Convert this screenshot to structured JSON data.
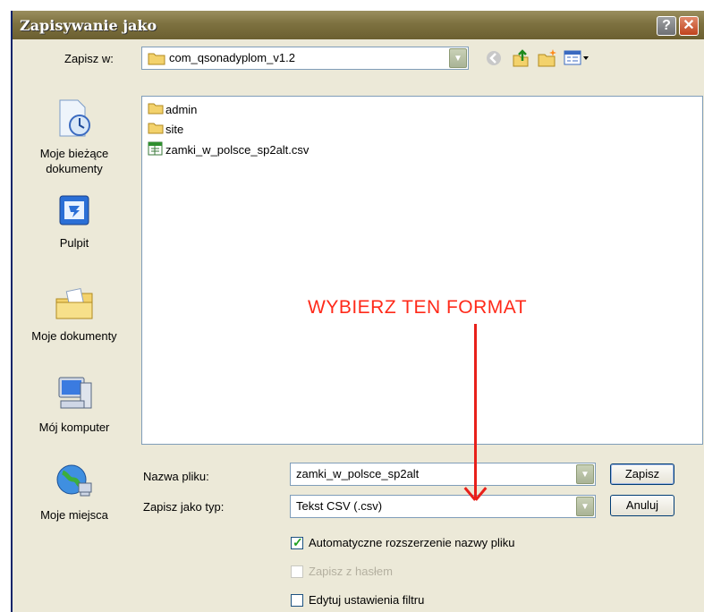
{
  "window": {
    "title": "Zapisywanie jako",
    "help_glyph": "?",
    "close_glyph": "✕"
  },
  "savein": {
    "label": "Zapisz w:",
    "label_underline": "p",
    "folder": "com_qsonadyplom_v1.2"
  },
  "places": [
    {
      "label_line1": "Moje bieżące",
      "label_line2": "dokumenty",
      "icon": "recent-documents-icon"
    },
    {
      "label_line1": "Pulpit",
      "icon": "desktop-icon"
    },
    {
      "label_line1": "Moje dokumenty",
      "icon": "my-documents-icon"
    },
    {
      "label_line1": "Mój komputer",
      "icon": "my-computer-icon"
    },
    {
      "label_line1": "Moje miejsca",
      "icon": "network-places-icon"
    }
  ],
  "files": [
    {
      "name": "admin",
      "icon": "folder-icon"
    },
    {
      "name": "site",
      "icon": "folder-icon"
    },
    {
      "name": "zamki_w_polsce_sp2alt.csv",
      "icon": "csv-file-icon"
    }
  ],
  "filename": {
    "label": "Nazwa pliku:",
    "value": "zamki_w_polsce_sp2alt"
  },
  "filetype": {
    "label": "Zapisz jako typ:",
    "value": "Tekst CSV (.csv)"
  },
  "buttons": {
    "save": "Zapisz",
    "cancel": "Anuluj"
  },
  "options": [
    {
      "label": "Automatyczne rozszerzenie nazwy pliku",
      "checked": true,
      "enabled": true
    },
    {
      "label": "Zapisz z hasłem",
      "checked": false,
      "enabled": false
    },
    {
      "label": "Edytuj ustawienia filtru",
      "checked": false,
      "enabled": true
    }
  ],
  "annotation": {
    "text": "WYBIERZ TEN FORMAT",
    "color": "#ff2a1a"
  }
}
